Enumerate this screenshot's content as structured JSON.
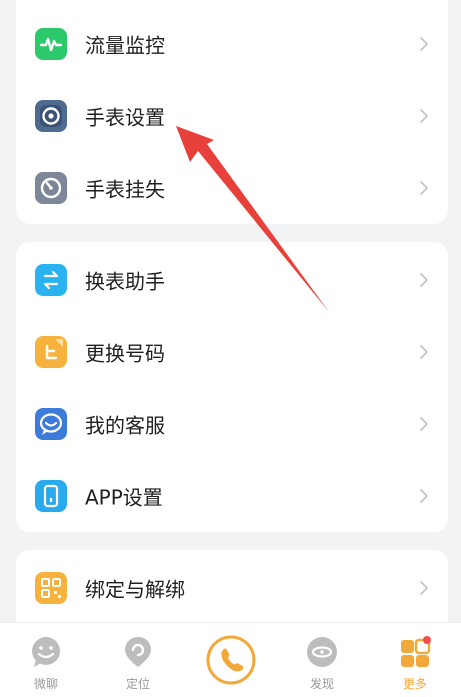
{
  "colors": {
    "accent": "#F2A93B",
    "annotation_arrow": "#E8413B",
    "green_icon": "#2CC96B",
    "blue_icon": "#3C7BD9",
    "gray_icon": "#7C8898",
    "cyan_icon": "#29B3F0",
    "orange_icon": "#F6B23C",
    "badge_red": "#F24C4C"
  },
  "menu": {
    "group1": [
      {
        "label": "流量监控",
        "icon": "activity-icon"
      },
      {
        "label": "手表设置",
        "icon": "watch-settings-icon"
      },
      {
        "label": "手表挂失",
        "icon": "watch-lost-icon"
      }
    ],
    "group2": [
      {
        "label": "换表助手",
        "icon": "switch-watch-icon"
      },
      {
        "label": "更换号码",
        "icon": "change-number-icon"
      },
      {
        "label": "我的客服",
        "icon": "customer-service-icon"
      },
      {
        "label": "APP设置",
        "icon": "app-settings-icon"
      }
    ],
    "group3": [
      {
        "label": "绑定与解绑",
        "icon": "qr-bind-icon"
      }
    ]
  },
  "tabbar": {
    "tabs": [
      {
        "label": "微聊",
        "icon": "chat-face-icon",
        "active": false
      },
      {
        "label": "定位",
        "icon": "location-pin-icon",
        "active": false
      },
      {
        "label": "",
        "icon": "call-icon",
        "active": false
      },
      {
        "label": "发现",
        "icon": "discover-eye-icon",
        "active": false
      },
      {
        "label": "更多",
        "icon": "more-apps-icon",
        "active": true
      }
    ]
  }
}
